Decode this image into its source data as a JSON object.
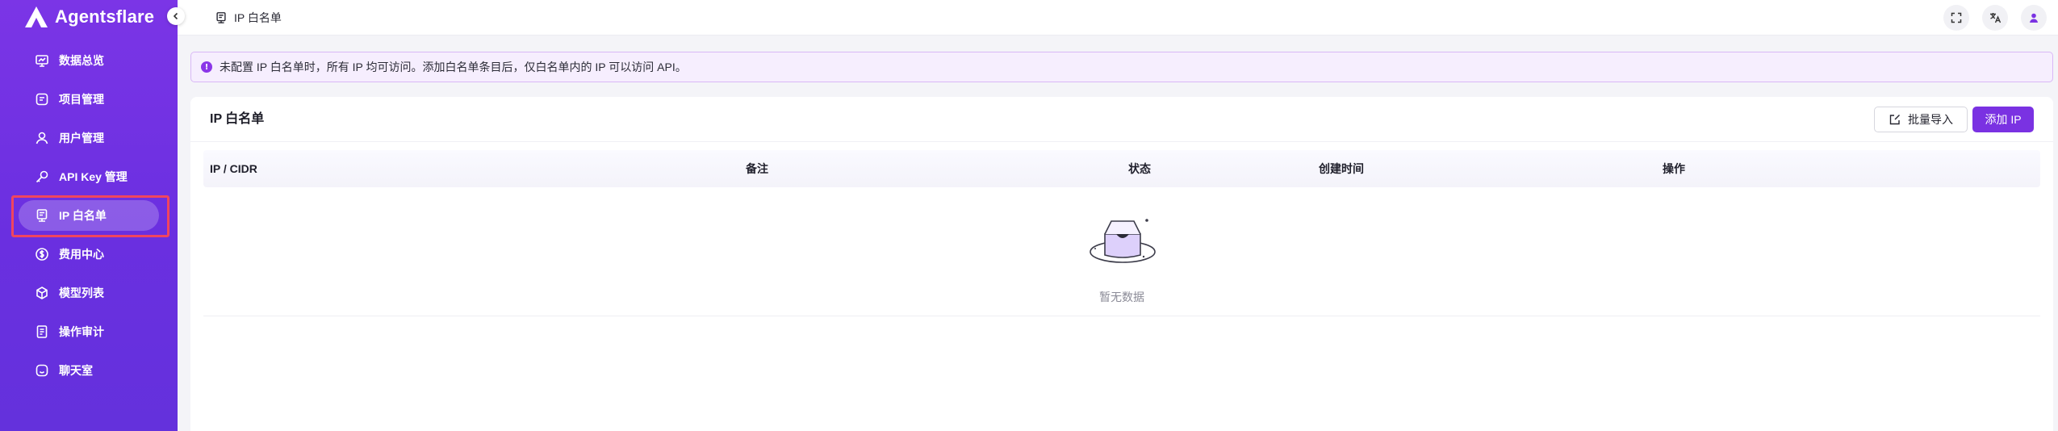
{
  "brand": {
    "name": "Agentsflare"
  },
  "sidebar": {
    "items": [
      {
        "label": "数据总览",
        "icon": "dashboard-icon"
      },
      {
        "label": "项目管理",
        "icon": "project-icon"
      },
      {
        "label": "用户管理",
        "icon": "user-icon"
      },
      {
        "label": "API Key 管理",
        "icon": "key-icon"
      },
      {
        "label": "IP 白名单",
        "icon": "server-icon",
        "active": true
      },
      {
        "label": "费用中心",
        "icon": "dollar-icon"
      },
      {
        "label": "模型列表",
        "icon": "model-icon"
      },
      {
        "label": "操作审计",
        "icon": "audit-icon"
      },
      {
        "label": "聊天室",
        "icon": "chat-icon"
      }
    ]
  },
  "topbar": {
    "breadcrumb": "IP 白名单",
    "actions": [
      "fullscreen-icon",
      "translate-icon",
      "avatar-icon"
    ]
  },
  "alert": {
    "text": "未配置 IP 白名单时，所有 IP 均可访问。添加白名单条目后，仅白名单内的 IP 可以访问 API。"
  },
  "card": {
    "title": "IP 白名单",
    "import_label": "批量导入",
    "add_label": "添加 IP"
  },
  "table": {
    "columns": [
      "IP / CIDR",
      "备注",
      "状态",
      "创建时间",
      "操作"
    ],
    "rows": [],
    "empty_text": "暂无数据"
  },
  "colors": {
    "accent": "#7a32e2",
    "sidebar_top": "#7b35e6",
    "alert_bg": "#f6eefe",
    "highlight": "#f0455f"
  }
}
